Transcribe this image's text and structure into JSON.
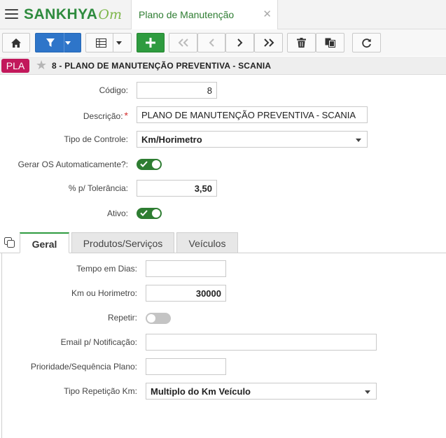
{
  "topbar": {
    "logo_brand": "SANKHYA",
    "logo_suffix": "Om",
    "tab_title": "Plano de Manutenção",
    "tab_close": "✕"
  },
  "record": {
    "badge": "PLA",
    "title": "8 - PLANO DE MANUTENÇÃO PREVENTIVA - SCANIA"
  },
  "form": {
    "codigo_label": "Código:",
    "codigo_value": "8",
    "descricao_label": "Descrição:",
    "descricao_required": "*",
    "descricao_value": "PLANO DE MANUTENÇÃO PREVENTIVA - SCANIA",
    "tipo_controle_label": "Tipo de Controle:",
    "tipo_controle_value": "Km/Horimetro",
    "gerar_os_label": "Gerar OS Automaticamente?:",
    "gerar_os_on": true,
    "tolerancia_label": "% p/ Tolerância:",
    "tolerancia_value": "3,50",
    "ativo_label": "Ativo:",
    "ativo_on": true
  },
  "tabs": [
    {
      "label": "Geral",
      "active": true
    },
    {
      "label": "Produtos/Serviços",
      "active": false
    },
    {
      "label": "Veículos",
      "active": false
    }
  ],
  "geral": {
    "tempo_dias_label": "Tempo em Dias:",
    "tempo_dias_value": "",
    "km_horimetro_label": "Km ou Horimetro:",
    "km_horimetro_value": "30000",
    "repetir_label": "Repetir:",
    "repetir_on": false,
    "email_label": "Email p/ Notificação:",
    "email_value": "",
    "prioridade_label": "Prioridade/Sequência Plano:",
    "prioridade_value": "",
    "tipo_repeticao_label": "Tipo Repetição Km:",
    "tipo_repeticao_value": "Multiplo do Km Veículo"
  },
  "colors": {
    "accent_green": "#2e9b3f",
    "filter_blue": "#2e75c9",
    "badge_magenta": "#c2185b"
  }
}
